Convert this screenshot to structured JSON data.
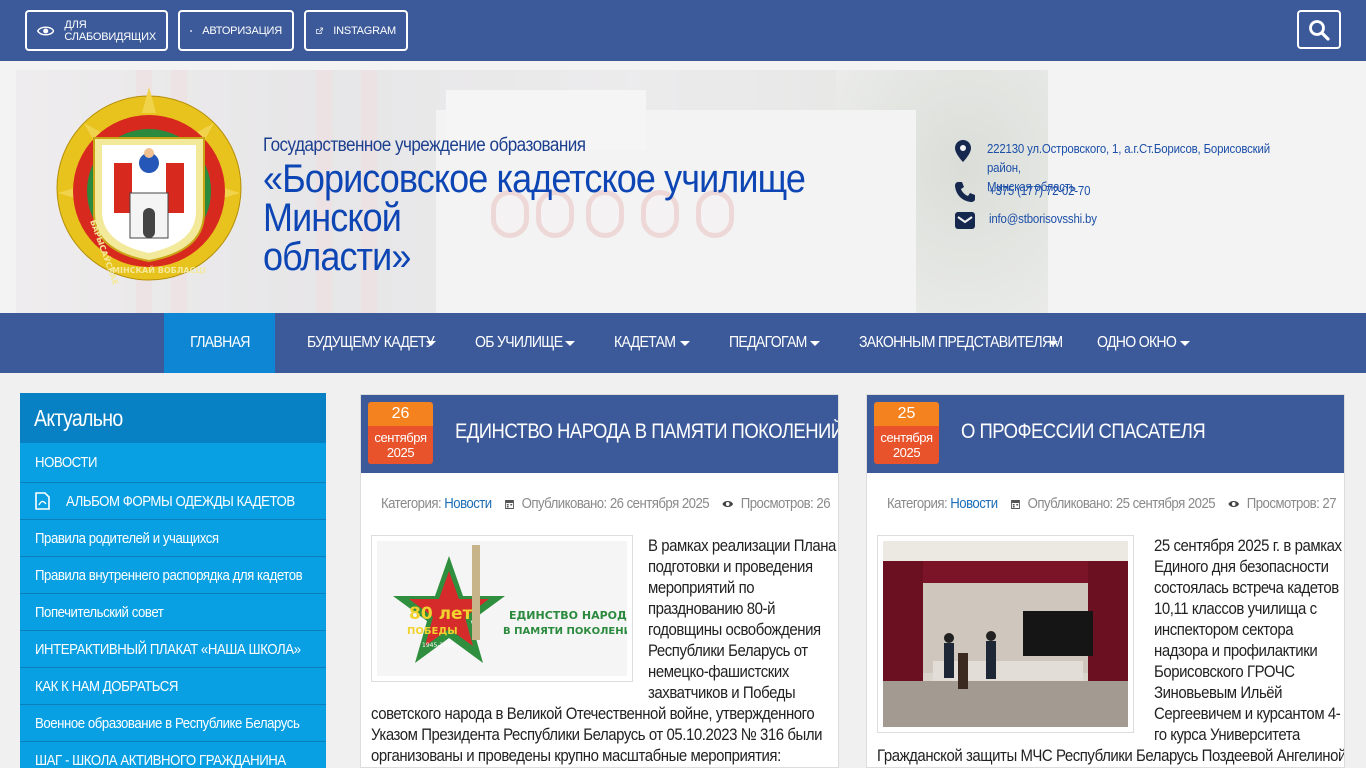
{
  "topbar": {
    "eye_label": "ДЛЯ СЛАБОВИДЯЩИХ",
    "auth_label": "АВТОРИЗАЦИЯ",
    "instagram_label": "INSTAGRAM"
  },
  "header": {
    "org_small": "Государственное учреждение образования",
    "org_big_line1": "«Борисовское кадетское училище Минской",
    "org_big_line2": "области»",
    "emblem_text_top": "БАРЫСАЎСКАЕ КАДЭЦКАЕ ВУЧЫЛІШЧА",
    "emblem_text_bottom": "МІНСКАЙ ВОБЛАСЦІ",
    "address_line1": "222130 ул.Островского, 1, а.г.Ст.Борисов, Борисовский район,",
    "address_line2": "Минская область",
    "phone": "+375 (177) 72-02-70",
    "email": "info@stborisovsshi.by"
  },
  "nav": {
    "items": [
      {
        "label": "ГЛАВНАЯ"
      },
      {
        "label": "БУДУЩЕМУ КАДЕТУ"
      },
      {
        "label": "ОБ УЧИЛИЩЕ"
      },
      {
        "label": "КАДЕТАМ"
      },
      {
        "label": "ПЕДАГОГАМ"
      },
      {
        "label": "ЗАКОННЫМ ПРЕДСТАВИТЕЛЯМ"
      },
      {
        "label": "ОДНО ОКНО"
      }
    ]
  },
  "sidebar": {
    "title": "Актуально",
    "items": [
      {
        "label": "НОВОСТИ"
      },
      {
        "label": "АЛЬБОМ ФОРМЫ ОДЕЖДЫ КАДЕТОВ"
      },
      {
        "label": "Правила родителей и учащихся"
      },
      {
        "label": "Правила внутреннего распорядка для кадетов"
      },
      {
        "label": "Попечительский совет"
      },
      {
        "label": "ИНТЕРАКТИВНЫЙ ПЛАКАТ «НАША ШКОЛА»"
      },
      {
        "label": "КАК К НАМ ДОБРАТЬСЯ"
      },
      {
        "label": "Военное образование в Республике Беларусь"
      },
      {
        "label": "ШАГ - ШКОЛА АКТИВНОГО ГРАЖДАНИНА"
      }
    ]
  },
  "articles": [
    {
      "day": "26",
      "month": "сентября",
      "year": "2025",
      "title": "ЕДИНСТВО НАРОДА В ПАМЯТИ ПОКОЛЕНИЙ",
      "category_label": "Категория:",
      "category": "Новости",
      "published": "Опубликовано: 26 сентября 2025",
      "views": "Просмотров: 26",
      "image_text_1": "80 лет",
      "image_text_2": "ПОБЕДЫ",
      "image_text_3": "1945-2025",
      "image_text_4": "ЕДИНСТВО НАРОДА",
      "image_text_5": "В ПАМЯТИ ПОКОЛЕНИЙ",
      "text_lines": [
        "В рамках реализации Плана",
        "подготовки и проведения",
        "мероприятий по",
        "празднованию 80-й",
        "годовщины освобождения",
        "Республики Беларусь от",
        "немецко-фашистских",
        "захватчиков и Победы",
        "советского народа в Великой Отечественной войне, утвержденного",
        "Указом Президента Республики Беларусь от 05.10.2023 № 316 были",
        "организованы и проведены крупно масштабные мероприятия:"
      ]
    },
    {
      "day": "25",
      "month": "сентября",
      "year": "2025",
      "title": "О ПРОФЕССИИ СПАСАТЕЛЯ",
      "category_label": "Категория:",
      "category": "Новости",
      "published": "Опубликовано: 25 сентября 2025",
      "views": "Просмотров: 27",
      "text_lines": [
        "25 сентября 2025 г. в рамках",
        "Единого дня безопасности",
        "состоялась встреча кадетов",
        "10,11 классов училища с",
        "инспектором сектора",
        "надзора и профилактики",
        "Борисовского ГРОЧС",
        "Зиновьевым Ильёй",
        "Сергеевичем и курсантом 4-",
        "го курса Университета",
        "Гражданской защиты МЧС Республики Беларусь Поздеевой Ангелиной."
      ]
    }
  ],
  "colors": {
    "bar_blue": "#3c5a9a",
    "sidebar_blue": "#09a0e3",
    "active_nav": "#0e86d4",
    "date_orange": "#f4831f",
    "date_red": "#e8532b"
  }
}
